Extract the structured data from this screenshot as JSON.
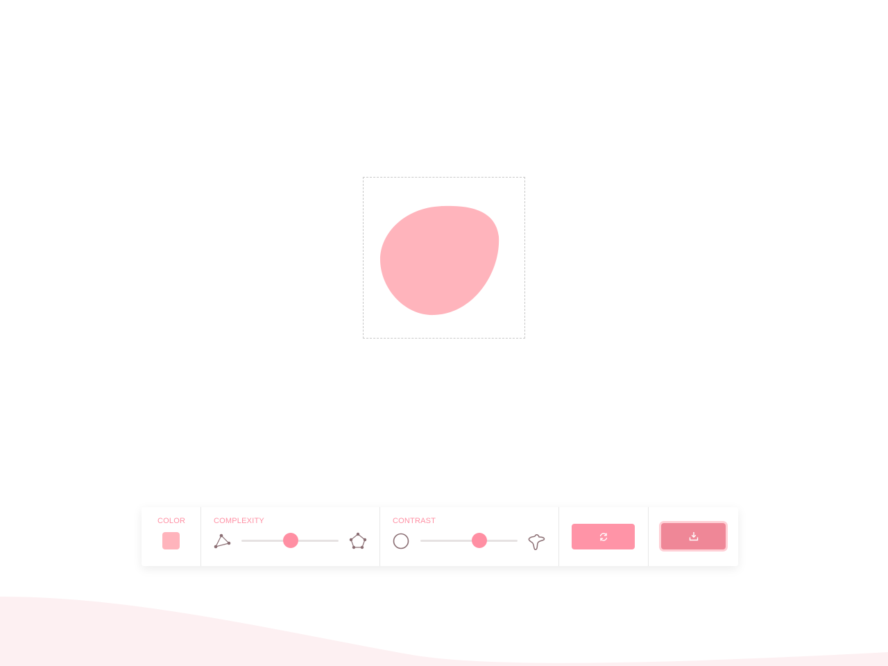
{
  "colors": {
    "blob": "#ffb4bc",
    "accent": "#ff94a7",
    "download": "#ef8797",
    "icon": "#8a6d72",
    "wave": "#fdf0f2"
  },
  "toolbar": {
    "color": {
      "label": "COLOR",
      "value": "#ffb4bc"
    },
    "complexity": {
      "label": "COMPLEXITY",
      "value": 0.51,
      "min_icon": "triangle-nodes-icon",
      "max_icon": "pentagon-nodes-icon"
    },
    "contrast": {
      "label": "CONTRAST",
      "value": 0.61,
      "min_icon": "circle-icon",
      "max_icon": "irregular-blob-icon"
    },
    "regenerate": {
      "icon": "refresh-icon"
    },
    "download": {
      "icon": "download-icon"
    }
  }
}
